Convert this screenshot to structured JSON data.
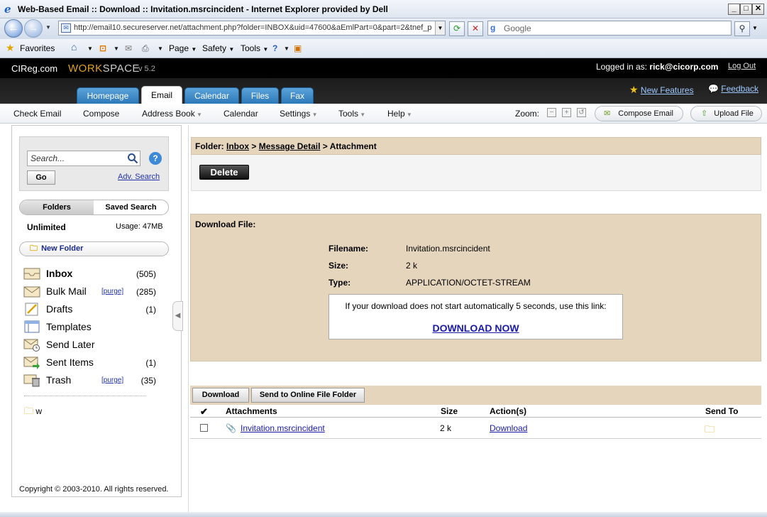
{
  "browser": {
    "window_title": "Web-Based Email :: Download :: Invitation.msrcincident - Internet Explorer provided by Dell",
    "url": "http://email10.secureserver.net/attachment.php?folder=INBOX&uid=47600&aEmlPart=0&part=2&tnef_p",
    "search_placeholder": "Google",
    "favorites_label": "Favorites",
    "page_menu": "Page",
    "safety_menu": "Safety",
    "tools_menu": "Tools"
  },
  "app": {
    "brand": "CIReg.com",
    "workspace_a": "WORK",
    "workspace_b": "SPACE",
    "version": "v 5.2",
    "logged_in_prefix": "Logged in as:",
    "logged_in_user": "rick@cicorp.com",
    "logout": "Log Out",
    "new_features": "New Features",
    "feedback": "Feedback",
    "tabs": [
      "Homepage",
      "Email",
      "Calendar",
      "Files",
      "Fax"
    ],
    "active_tab": "Email"
  },
  "menu": {
    "check_email": "Check Email",
    "compose": "Compose",
    "address_book": "Address Book",
    "calendar": "Calendar",
    "settings": "Settings",
    "tools": "Tools",
    "help": "Help",
    "zoom": "Zoom:",
    "compose_email": "Compose Email",
    "upload_file": "Upload File"
  },
  "sidebar": {
    "search_placeholder": "Search...",
    "go": "Go",
    "adv_search": "Adv. Search",
    "tab_folders": "Folders",
    "tab_saved": "Saved Search",
    "quota": "Unlimited",
    "usage": "Usage: 47MB",
    "new_folder": "New Folder",
    "folders": [
      {
        "name": "Inbox",
        "count": "(505)",
        "purge": ""
      },
      {
        "name": "Bulk Mail",
        "count": "(285)",
        "purge": "[purge]"
      },
      {
        "name": "Drafts",
        "count": "(1)",
        "purge": ""
      },
      {
        "name": "Templates",
        "count": "",
        "purge": ""
      },
      {
        "name": "Send Later",
        "count": "",
        "purge": ""
      },
      {
        "name": "Sent Items",
        "count": "(1)",
        "purge": ""
      },
      {
        "name": "Trash",
        "count": "(35)",
        "purge": "[purge]"
      }
    ],
    "custom_folder": "w",
    "copyright": "Copyright © 2003-2010. All rights reserved."
  },
  "main": {
    "folder_label": "Folder:",
    "crumb_inbox": "Inbox",
    "crumb_sep1": ">",
    "crumb_detail": "Message Detail",
    "crumb_sep2": ">",
    "crumb_current": "Attachment",
    "delete": "Delete",
    "download_file_heading": "Download File:",
    "filename_label": "Filename:",
    "filename_value": "Invitation.msrcincident",
    "size_label": "Size:",
    "size_value": "2 k",
    "type_label": "Type:",
    "type_value": "APPLICATION/OCTET-STREAM",
    "download_msg": "If your download does not start automatically 5 seconds, use this link:",
    "download_now": "DOWNLOAD NOW",
    "btn_download": "Download",
    "btn_send_online": "Send to Online File Folder",
    "table": {
      "headers": [
        "Attachments",
        "Size",
        "Action(s)",
        "Send To"
      ],
      "rows": [
        {
          "name": "Invitation.msrcincident",
          "size": "2 k",
          "action": "Download"
        }
      ]
    }
  }
}
